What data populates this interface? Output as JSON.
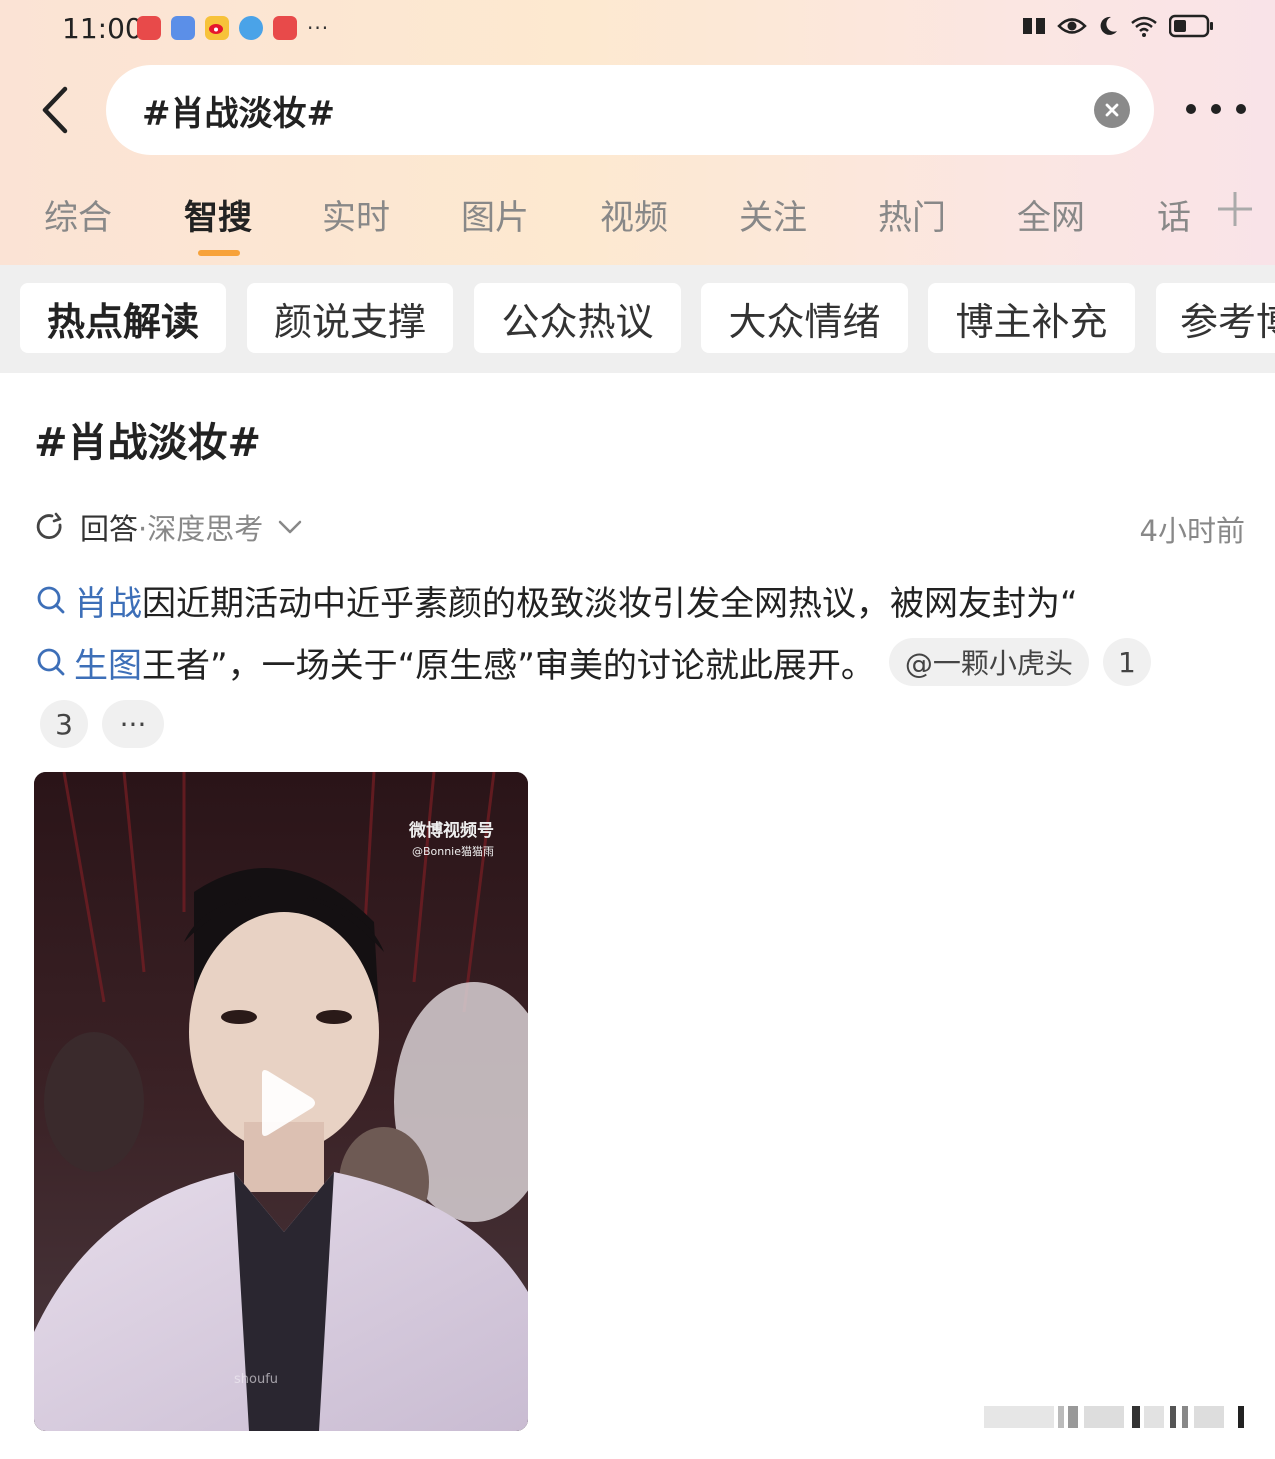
{
  "status_bar": {
    "time": "11:00",
    "notifications": [
      "app-red-icon",
      "app-blue-icon",
      "weibo-icon",
      "browser-icon",
      "app-red-icon"
    ],
    "overflow": "···"
  },
  "search": {
    "query": "#肖战淡妆#"
  },
  "tabs": [
    {
      "label": "综合",
      "active": false
    },
    {
      "label": "智搜",
      "active": true
    },
    {
      "label": "实时",
      "active": false
    },
    {
      "label": "图片",
      "active": false
    },
    {
      "label": "视频",
      "active": false
    },
    {
      "label": "关注",
      "active": false
    },
    {
      "label": "热门",
      "active": false
    },
    {
      "label": "全网",
      "active": false
    },
    {
      "label": "话",
      "active": false
    }
  ],
  "chips": [
    {
      "label": "热点解读",
      "active": true
    },
    {
      "label": "颜说支撑",
      "active": false
    },
    {
      "label": "公众热议",
      "active": false
    },
    {
      "label": "大众情绪",
      "active": false
    },
    {
      "label": "博主补充",
      "active": false
    },
    {
      "label": "参考博",
      "active": false
    }
  ],
  "content": {
    "title": "#肖战淡妆#",
    "answer_label": "回答",
    "answer_mode": "·深度思考",
    "time_ago": "4小时前",
    "paragraph": {
      "kw1": "肖战",
      "text1": "因近期活动中近乎素颜的极致淡妆引发全网热议，被网友封为“",
      "kw2": "生图",
      "text2": "王者”，一场关于“原生感”审美的讨论就此展开。",
      "mention": "@一颗小虎头",
      "ref1": "1",
      "ref2": "3",
      "more": "···"
    },
    "video": {
      "watermark_line1": "微博视频号",
      "watermark_line2": "@Bonnie猫猫雨",
      "bottom_watermark": "shoufu"
    }
  },
  "colors": {
    "accent": "#f7a23a",
    "link": "#3d6fb8",
    "chip_bg": "#efefef"
  }
}
